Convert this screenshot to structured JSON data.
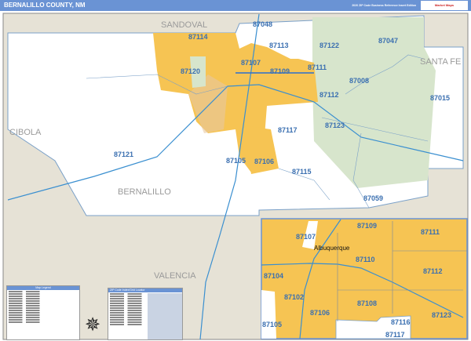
{
  "header": {
    "title": "BERNALILLO COUNTY, NM",
    "edition": "2020 ZIP Code Business Reference Insert Edition",
    "logo": "Market Maps"
  },
  "colors": {
    "header": "#6a93d4",
    "urban": "#f6c453",
    "forest": "#d7e5cc",
    "outside": "#e6e2d6",
    "zip_line": "#3a6fb0"
  },
  "counties": {
    "sandoval": "SANDOVAL",
    "santa_fe": "SANTA FE",
    "cibola": "CIBOLA",
    "bernalillo": "BERNALILLO",
    "valencia": "VALENCIA"
  },
  "zips": {
    "z87048": "87048",
    "z87114": "87114",
    "z87113": "87113",
    "z87122": "87122",
    "z87047": "87047",
    "z87120": "87120",
    "z87107": "87107",
    "z87109": "87109",
    "z87111": "87111",
    "z87008": "87008",
    "z87015": "87015",
    "z87112": "87112",
    "z87123": "87123",
    "z87117": "87117",
    "z87121": "87121",
    "z87105": "87105",
    "z87106": "87106",
    "z87115": "87115",
    "z87059": "87059"
  },
  "inset": {
    "city": "Albuquerque",
    "z87109": "87109",
    "z87107": "87107",
    "z87111": "87111",
    "z87110": "87110",
    "z87112": "87112",
    "z87102": "87102",
    "z87104": "87104",
    "z87108": "87108",
    "z87106": "87106",
    "z87123": "87123",
    "z87105": "87105",
    "z87116": "87116",
    "z87117": "87117"
  },
  "legend": {
    "title": "Map Legend"
  },
  "zip_table": {
    "title": "ZIP Code Index/Grid Locator"
  }
}
